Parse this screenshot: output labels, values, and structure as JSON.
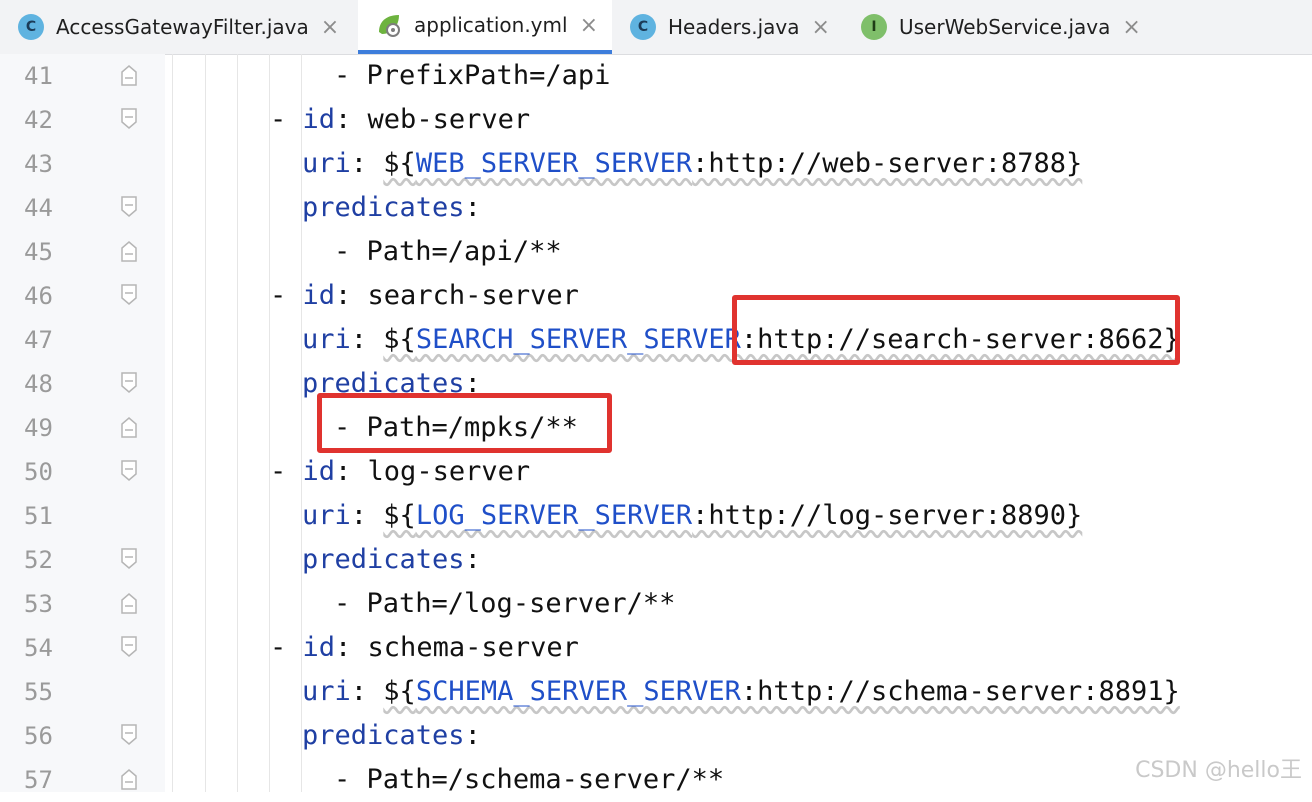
{
  "tabs": [
    {
      "label": "AccessGatewayFilter.java",
      "icon": "class-icon",
      "glyph": "C",
      "active": false
    },
    {
      "label": "application.yml",
      "icon": "spring-yaml-icon",
      "glyph": "",
      "active": true
    },
    {
      "label": "Headers.java",
      "icon": "class-icon",
      "glyph": "C",
      "active": false
    },
    {
      "label": "UserWebService.java",
      "icon": "interface-icon",
      "glyph": "I",
      "active": false
    }
  ],
  "close_glyph": "×",
  "lines": [
    {
      "num": "41",
      "dash": "- ",
      "key": "",
      "colon": "",
      "rest": "PrefixPath=/api"
    },
    {
      "num": "42",
      "dash": "- ",
      "key": "id",
      "colon": ": ",
      "rest": "web-server"
    },
    {
      "num": "43",
      "dash": "",
      "key": "uri",
      "colon": ": ",
      "pre": "${",
      "env": "WEB_SERVER_SERVER",
      "rest": ":http://web-server:8788}"
    },
    {
      "num": "44",
      "dash": "",
      "key": "predicates",
      "colon": ":",
      "rest": ""
    },
    {
      "num": "45",
      "dash": "- ",
      "key": "",
      "colon": "",
      "rest": "Path=/api/**"
    },
    {
      "num": "46",
      "dash": "- ",
      "key": "id",
      "colon": ": ",
      "rest": "search-server"
    },
    {
      "num": "47",
      "dash": "",
      "key": "uri",
      "colon": ": ",
      "pre": "${",
      "env": "SEARCH_SERVER_SERVER",
      "rest": ":http://search-server:8662}"
    },
    {
      "num": "48",
      "dash": "",
      "key": "predicates",
      "colon": ":",
      "rest": ""
    },
    {
      "num": "49",
      "dash": "- ",
      "key": "",
      "colon": "",
      "rest": "Path=/mpks/**"
    },
    {
      "num": "50",
      "dash": "- ",
      "key": "id",
      "colon": ": ",
      "rest": "log-server"
    },
    {
      "num": "51",
      "dash": "",
      "key": "uri",
      "colon": ": ",
      "pre": "${",
      "env": "LOG_SERVER_SERVER",
      "rest": ":http://log-server:8890}"
    },
    {
      "num": "52",
      "dash": "",
      "key": "predicates",
      "colon": ":",
      "rest": ""
    },
    {
      "num": "53",
      "dash": "- ",
      "key": "",
      "colon": "",
      "rest": "Path=/log-server/**"
    },
    {
      "num": "54",
      "dash": "- ",
      "key": "id",
      "colon": ": ",
      "rest": "schema-server"
    },
    {
      "num": "55",
      "dash": "",
      "key": "uri",
      "colon": ": ",
      "pre": "${",
      "env": "SCHEMA_SERVER_SERVER",
      "rest": ":http://schema-server:8891}"
    },
    {
      "num": "56",
      "dash": "",
      "key": "predicates",
      "colon": ":",
      "rest": ""
    },
    {
      "num": "57",
      "dash": "- ",
      "key": "",
      "colon": "",
      "rest": "Path=/schema-server/**"
    }
  ],
  "watermark": "CSDN @hello王",
  "colors": {
    "highlight": "#e0332f",
    "key": "#1f3fa3",
    "active_tab_underline": "#3d7ddb"
  }
}
